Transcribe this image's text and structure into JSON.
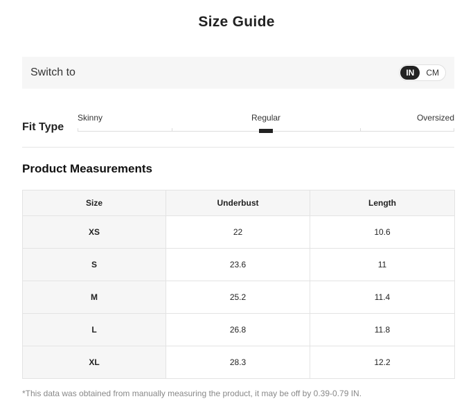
{
  "title": "Size Guide",
  "switch": {
    "label": "Switch to",
    "options": [
      "IN",
      "CM"
    ],
    "selected": "IN"
  },
  "fit_type": {
    "label": "Fit Type",
    "options": [
      "Skinny",
      "Regular",
      "Oversized"
    ],
    "selected": "Regular"
  },
  "section_title": "Product Measurements",
  "table": {
    "headers": [
      "Size",
      "Underbust",
      "Length"
    ],
    "rows": [
      [
        "XS",
        "22",
        "10.6"
      ],
      [
        "S",
        "23.6",
        "11"
      ],
      [
        "M",
        "25.2",
        "11.4"
      ],
      [
        "L",
        "26.8",
        "11.8"
      ],
      [
        "XL",
        "28.3",
        "12.2"
      ]
    ]
  },
  "footnote": "*This data was obtained from manually measuring the product, it may be off by 0.39-0.79 IN."
}
